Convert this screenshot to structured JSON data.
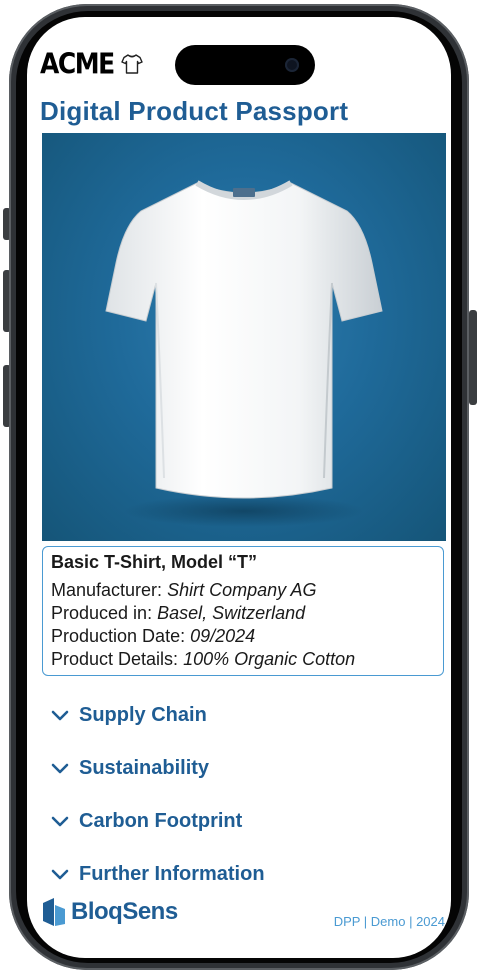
{
  "header": {
    "brand": "ACME",
    "brand_icon": "t-shirt-icon",
    "title": "Digital Product Passport"
  },
  "product": {
    "image_label": "t-shirt-photo",
    "name": "Basic T-Shirt, Model “T”",
    "details": [
      {
        "label": "Manufacturer:",
        "value": "Shirt Company AG"
      },
      {
        "label": "Produced in:",
        "value": "Basel, Switzerland"
      },
      {
        "label": "Production Date:",
        "value": "09/2024"
      },
      {
        "label": "Product Details:",
        "value": "100% Organic Cotton"
      }
    ]
  },
  "sections": [
    {
      "label": "Supply Chain",
      "icon": "chevron-down-icon"
    },
    {
      "label": "Sustainability",
      "icon": "chevron-down-icon"
    },
    {
      "label": "Carbon Footprint",
      "icon": "chevron-down-icon"
    },
    {
      "label": "Further Information",
      "icon": "chevron-down-icon"
    }
  ],
  "footer": {
    "brand": "BloqSens",
    "meta": "DPP | Demo | 2024"
  },
  "colors": {
    "accent": "#1f5d94",
    "card_border": "#4a9ad2",
    "image_background": "#1f6a9a"
  }
}
